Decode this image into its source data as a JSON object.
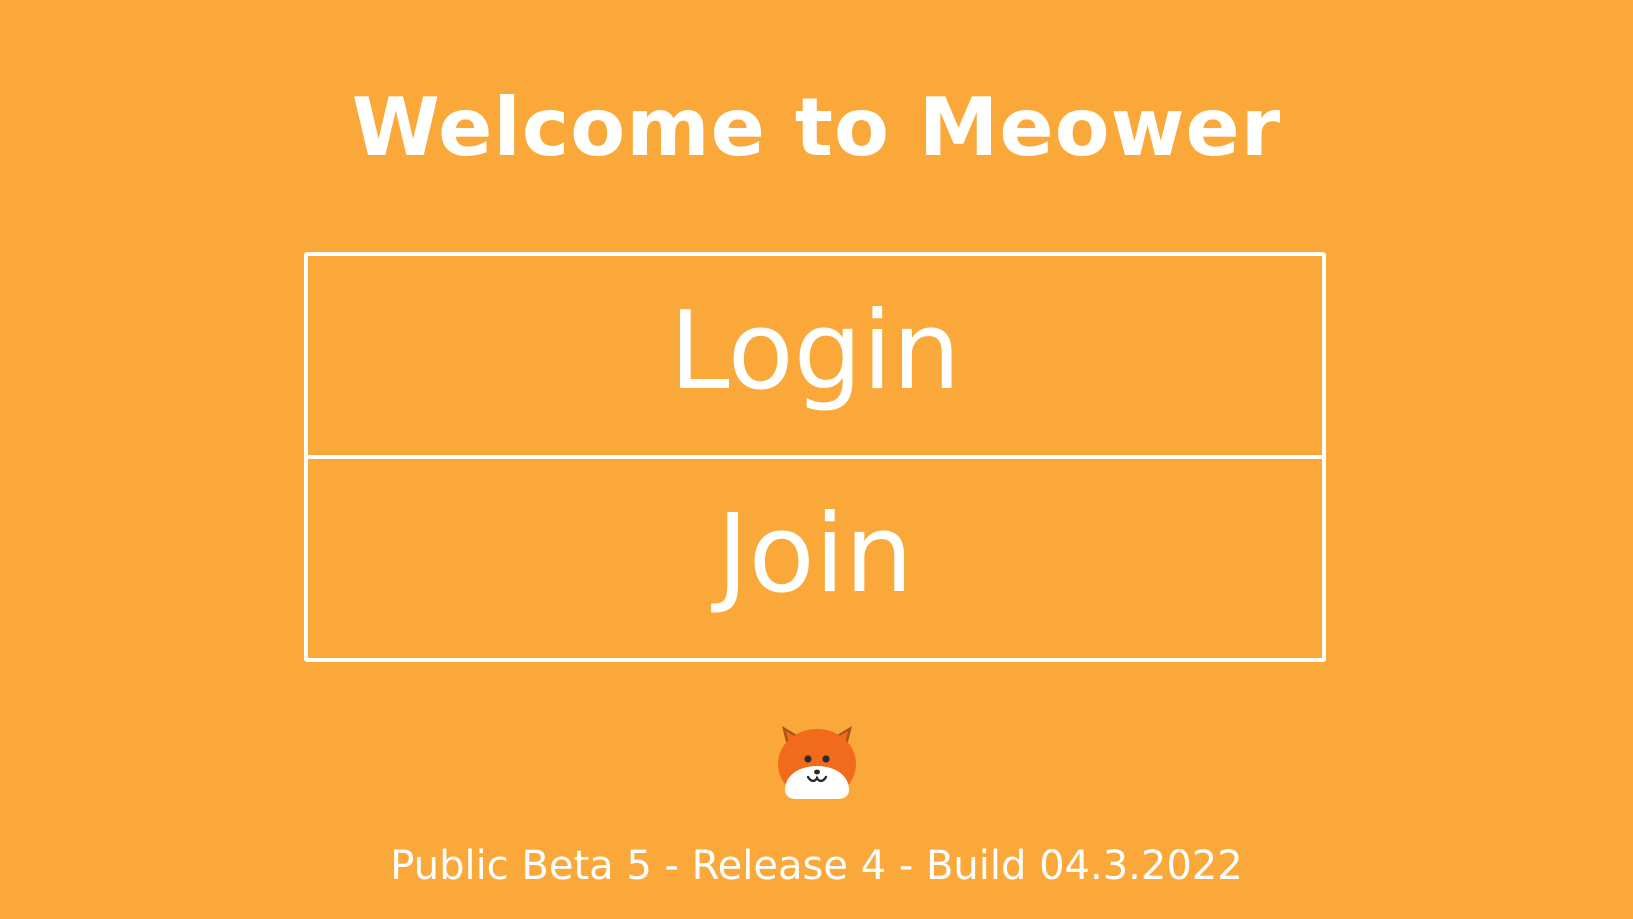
{
  "app": {
    "title": "Welcome to Meower"
  },
  "menu": {
    "login_label": "Login",
    "join_label": "Join"
  },
  "logo": {
    "icon": "cat-face-icon"
  },
  "footer": {
    "version": "Public Beta 5 - Release 4 - Build 04.3.2022"
  },
  "colors": {
    "background": "#F9A839",
    "foreground": "#FFFFFF",
    "logo_orange": "#F26A1B",
    "logo_ear_dark": "#A8551E"
  }
}
